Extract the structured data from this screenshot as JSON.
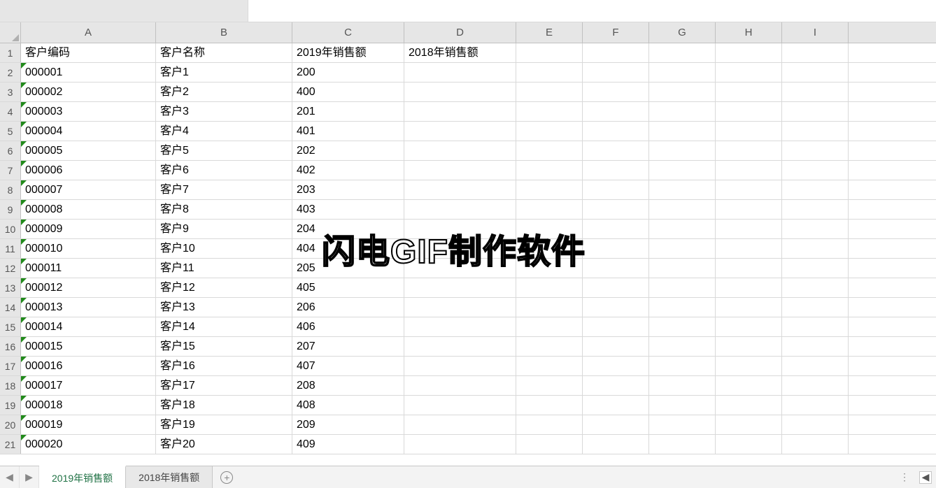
{
  "formula_bar": {
    "name_box": "",
    "formula": ""
  },
  "columns": [
    "A",
    "B",
    "C",
    "D",
    "E",
    "F",
    "G",
    "H",
    "I"
  ],
  "headers": {
    "A": "客户编码",
    "B": "客户名称",
    "C": "2019年销售额",
    "D": "2018年销售额"
  },
  "rows": [
    {
      "n": 1,
      "a": "客户编码",
      "b": "客户名称",
      "c": "2019年销售额",
      "d": "2018年销售额",
      "numflag": false
    },
    {
      "n": 2,
      "a": "000001",
      "b": "客户1",
      "c": "200",
      "d": "",
      "numflag": true
    },
    {
      "n": 3,
      "a": "000002",
      "b": "客户2",
      "c": "400",
      "d": "",
      "numflag": true
    },
    {
      "n": 4,
      "a": "000003",
      "b": "客户3",
      "c": "201",
      "d": "",
      "numflag": true
    },
    {
      "n": 5,
      "a": "000004",
      "b": "客户4",
      "c": "401",
      "d": "",
      "numflag": true
    },
    {
      "n": 6,
      "a": "000005",
      "b": "客户5",
      "c": "202",
      "d": "",
      "numflag": true
    },
    {
      "n": 7,
      "a": "000006",
      "b": "客户6",
      "c": "402",
      "d": "",
      "numflag": true
    },
    {
      "n": 8,
      "a": "000007",
      "b": "客户7",
      "c": "203",
      "d": "",
      "numflag": true
    },
    {
      "n": 9,
      "a": "000008",
      "b": "客户8",
      "c": "403",
      "d": "",
      "numflag": true
    },
    {
      "n": 10,
      "a": "000009",
      "b": "客户9",
      "c": "204",
      "d": "",
      "numflag": true
    },
    {
      "n": 11,
      "a": "000010",
      "b": "客户10",
      "c": "404",
      "d": "",
      "numflag": true
    },
    {
      "n": 12,
      "a": "000011",
      "b": "客户11",
      "c": "205",
      "d": "",
      "numflag": true
    },
    {
      "n": 13,
      "a": "000012",
      "b": "客户12",
      "c": "405",
      "d": "",
      "numflag": true
    },
    {
      "n": 14,
      "a": "000013",
      "b": "客户13",
      "c": "206",
      "d": "",
      "numflag": true
    },
    {
      "n": 15,
      "a": "000014",
      "b": "客户14",
      "c": "406",
      "d": "",
      "numflag": true
    },
    {
      "n": 16,
      "a": "000015",
      "b": "客户15",
      "c": "207",
      "d": "",
      "numflag": true
    },
    {
      "n": 17,
      "a": "000016",
      "b": "客户16",
      "c": "407",
      "d": "",
      "numflag": true
    },
    {
      "n": 18,
      "a": "000017",
      "b": "客户17",
      "c": "208",
      "d": "",
      "numflag": true
    },
    {
      "n": 19,
      "a": "000018",
      "b": "客户18",
      "c": "408",
      "d": "",
      "numflag": true
    },
    {
      "n": 20,
      "a": "000019",
      "b": "客户19",
      "c": "209",
      "d": "",
      "numflag": true
    },
    {
      "n": 21,
      "a": "000020",
      "b": "客户20",
      "c": "409",
      "d": "",
      "numflag": true
    }
  ],
  "sheet_tabs": {
    "active": "2019年销售额",
    "tabs": [
      "2019年销售额",
      "2018年销售额"
    ]
  },
  "watermark": "闪电GIF制作软件",
  "icons": {
    "nav_prev": "◀",
    "nav_next": "▶",
    "plus": "+",
    "dots": "⋮",
    "scroll_left": "◀"
  }
}
